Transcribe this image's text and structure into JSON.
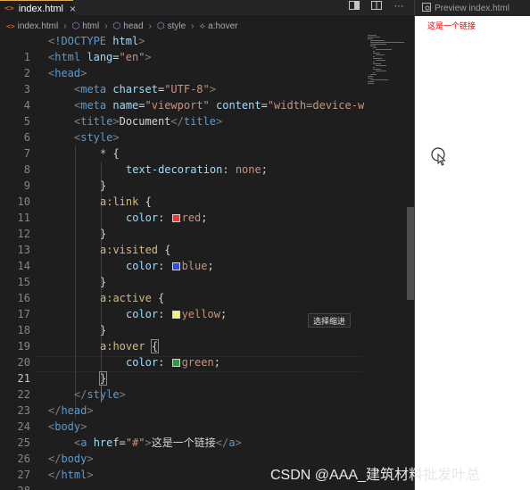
{
  "editor": {
    "tab": {
      "label": "index.html",
      "file_icon": "<>",
      "close": "×"
    },
    "breadcrumb": [
      "index.html",
      "html",
      "head",
      "style",
      "a:hover"
    ],
    "toolbar_icons": [
      "open-preview-icon",
      "split-editor-icon",
      "more-actions-icon"
    ],
    "current_line": 21,
    "tooltip": "选择缩进"
  },
  "code_lines": [
    {
      "n": "1"
    },
    {
      "n": "2"
    },
    {
      "n": "3"
    },
    {
      "n": "4"
    },
    {
      "n": "5"
    },
    {
      "n": "6"
    },
    {
      "n": "7"
    },
    {
      "n": "8"
    },
    {
      "n": "9"
    },
    {
      "n": "10"
    },
    {
      "n": "11"
    },
    {
      "n": "12"
    },
    {
      "n": "13"
    },
    {
      "n": "14"
    },
    {
      "n": "15"
    },
    {
      "n": "16"
    },
    {
      "n": "17"
    },
    {
      "n": "18"
    },
    {
      "n": "19"
    },
    {
      "n": "20"
    },
    {
      "n": "21"
    },
    {
      "n": "22"
    },
    {
      "n": "23"
    },
    {
      "n": "24"
    },
    {
      "n": "25"
    },
    {
      "n": "26"
    },
    {
      "n": "27"
    },
    {
      "n": "28"
    }
  ],
  "code": {
    "l1_doctype": "!DOCTYPE",
    "l1_html": "html",
    "html_tag": "html",
    "lang_attr": "lang",
    "lang_val": "\"en\"",
    "head_tag": "head",
    "meta_tag": "meta",
    "charset_attr": "charset",
    "charset_val": "\"UTF-8\"",
    "name_attr": "name",
    "name_val": "\"viewport\"",
    "content_attr": "content",
    "content_val": "\"width=device-w",
    "title_tag": "title",
    "title_text": "Document",
    "style_tag": "style",
    "universal_sel": "*",
    "text_decoration_prop": "text-decoration",
    "text_decoration_val": "none",
    "sel_link": "a:link",
    "sel_visited": "a:visited",
    "sel_active": "a:active",
    "sel_hover": "a:hover",
    "color_prop": "color",
    "val_red": "red",
    "val_blue": "blue",
    "val_yellow": "yellow",
    "val_green": "green",
    "body_tag": "body",
    "a_tag": "a",
    "href_attr": "href",
    "href_val": "\"#\"",
    "link_text": "这是一个链接"
  },
  "swatch_colors": {
    "red": "#e03c3c",
    "blue": "#2f4ee0",
    "yellow": "#f7f07a",
    "green": "#2c9b3c"
  },
  "preview": {
    "tab_label": "Preview index.html",
    "link_text": "这是一个链接",
    "link_color": "#ee0000"
  },
  "watermark": "CSDN @AAA_建筑材料批发叶总"
}
